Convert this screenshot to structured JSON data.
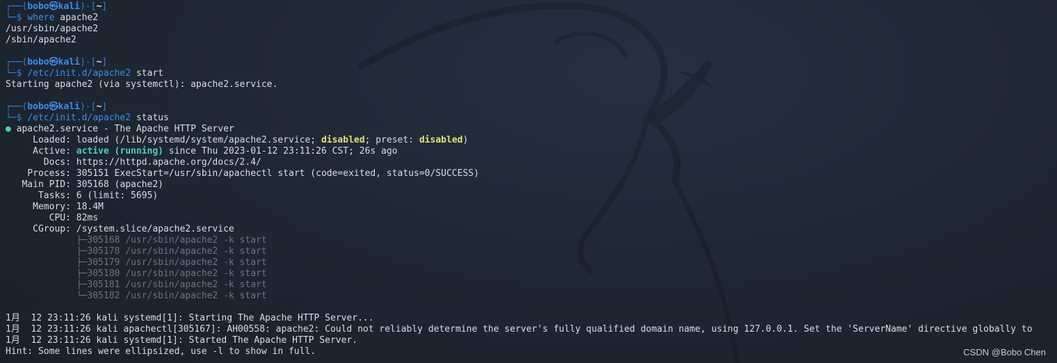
{
  "prompts": [
    {
      "frame_top": "┌──(",
      "user": "bobo",
      "at": "㉿",
      "host": "kali",
      "dir_open": ")-[",
      "dir": "~",
      "dir_close": "]",
      "frame_bottom": "└─$ ",
      "command": "where",
      "args": " apache2"
    },
    {
      "frame_top": "┌──(",
      "user": "bobo",
      "at": "㉿",
      "host": "kali",
      "dir_open": ")-[",
      "dir": "~",
      "dir_close": "]",
      "frame_bottom": "└─$ ",
      "command": "/etc/init.d/apache2",
      "args": " start"
    },
    {
      "frame_top": "┌──(",
      "user": "bobo",
      "at": "㉿",
      "host": "kali",
      "dir_open": ")-[",
      "dir": "~",
      "dir_close": "]",
      "frame_bottom": "└─$ ",
      "command": "/etc/init.d/apache2",
      "args": " status"
    }
  ],
  "where_output": [
    "/usr/sbin/apache2",
    "/sbin/apache2"
  ],
  "start_output": "Starting apache2 (via systemctl): apache2.service.",
  "status": {
    "bullet": "●",
    "header": " apache2.service - The Apache HTTP Server",
    "loaded_label": "     Loaded: ",
    "loaded_pre": "loaded (/lib/systemd/system/apache2.service; ",
    "loaded_state": "disabled",
    "loaded_mid": "; preset: ",
    "preset_state": "disabled",
    "loaded_post": ")",
    "active_label": "     Active: ",
    "active_state": "active (running)",
    "active_post": " since Thu 2023-01-12 23:11:26 CST; 26s ago",
    "fields": [
      {
        "label": "       Docs: ",
        "value": "https://httpd.apache.org/docs/2.4/"
      },
      {
        "label": "    Process: ",
        "value": "305151 ExecStart=/usr/sbin/apachectl start (code=exited, status=0/SUCCESS)"
      },
      {
        "label": "   Main PID: ",
        "value": "305168 (apache2)"
      },
      {
        "label": "      Tasks: ",
        "value": "6 (limit: 5695)"
      },
      {
        "label": "     Memory: ",
        "value": "18.4M"
      },
      {
        "label": "        CPU: ",
        "value": "82ms"
      },
      {
        "label": "     CGroup: ",
        "value": "/system.slice/apache2.service"
      }
    ],
    "cgroup_indent": "             ",
    "cgroup_tree": [
      {
        "branch": "├─",
        "proc": "305168 /usr/sbin/apache2 -k start"
      },
      {
        "branch": "├─",
        "proc": "305178 /usr/sbin/apache2 -k start"
      },
      {
        "branch": "├─",
        "proc": "305179 /usr/sbin/apache2 -k start"
      },
      {
        "branch": "├─",
        "proc": "305180 /usr/sbin/apache2 -k start"
      },
      {
        "branch": "├─",
        "proc": "305181 /usr/sbin/apache2 -k start"
      },
      {
        "branch": "└─",
        "proc": "305182 /usr/sbin/apache2 -k start"
      }
    ],
    "log_lines": [
      "1月  12 23:11:26 kali systemd[1]: Starting The Apache HTTP Server...",
      "1月  12 23:11:26 kali apachectl[305167]: AH00558: apache2: Could not reliably determine the server's fully qualified domain name, using 127.0.0.1. Set the 'ServerName' directive globally to",
      "1月  12 23:11:26 kali systemd[1]: Started The Apache HTTP Server."
    ],
    "hint": "Hint: Some lines were ellipsized, use -l to show in full."
  },
  "watermark": "CSDN @Bobo Chen",
  "colors": {
    "background": "#1f2430",
    "prompt_frame": "#2f80d8",
    "command": "#3b8eea",
    "status_dot": "#4fd0b4",
    "disabled_state": "#e5e07a",
    "active_state": "#4fd0b4",
    "cgroup_dim": "#6b7480"
  },
  "background_icon": "kali-dragon-icon"
}
